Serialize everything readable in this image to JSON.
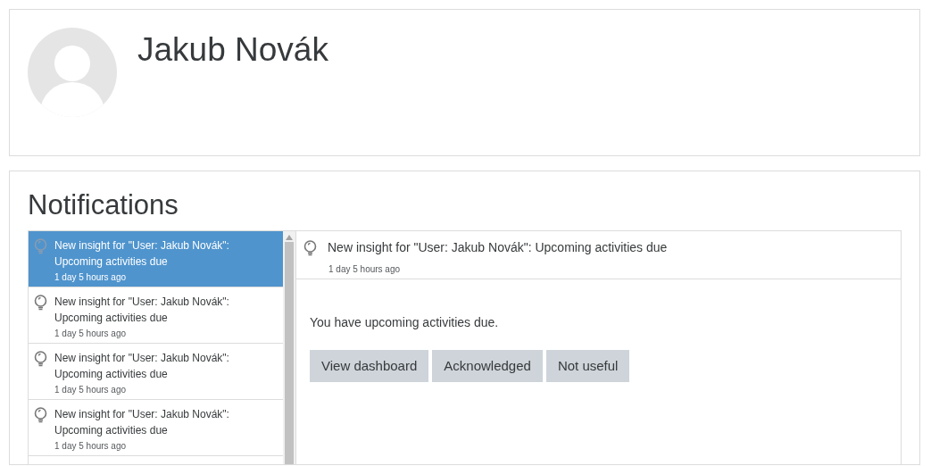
{
  "profile": {
    "name": "Jakub Novák"
  },
  "notifications": {
    "title": "Notifications",
    "items": [
      {
        "title": "New insight for \"User: Jakub Novák\": Upcoming activities due",
        "time": "1 day 5 hours ago",
        "selected": true
      },
      {
        "title": "New insight for \"User: Jakub Novák\": Upcoming activities due",
        "time": "1 day 5 hours ago",
        "selected": false
      },
      {
        "title": "New insight for \"User: Jakub Novák\": Upcoming activities due",
        "time": "1 day 5 hours ago",
        "selected": false
      },
      {
        "title": "New insight for \"User: Jakub Novák\": Upcoming activities due",
        "time": "1 day 5 hours ago",
        "selected": false
      }
    ],
    "detail": {
      "title": "New insight for \"User: Jakub Novák\": Upcoming activities due",
      "time": "1 day 5 hours ago",
      "message": "You have upcoming activities due.",
      "actions": [
        "View dashboard",
        "Acknowledged",
        "Not useful"
      ]
    }
  }
}
